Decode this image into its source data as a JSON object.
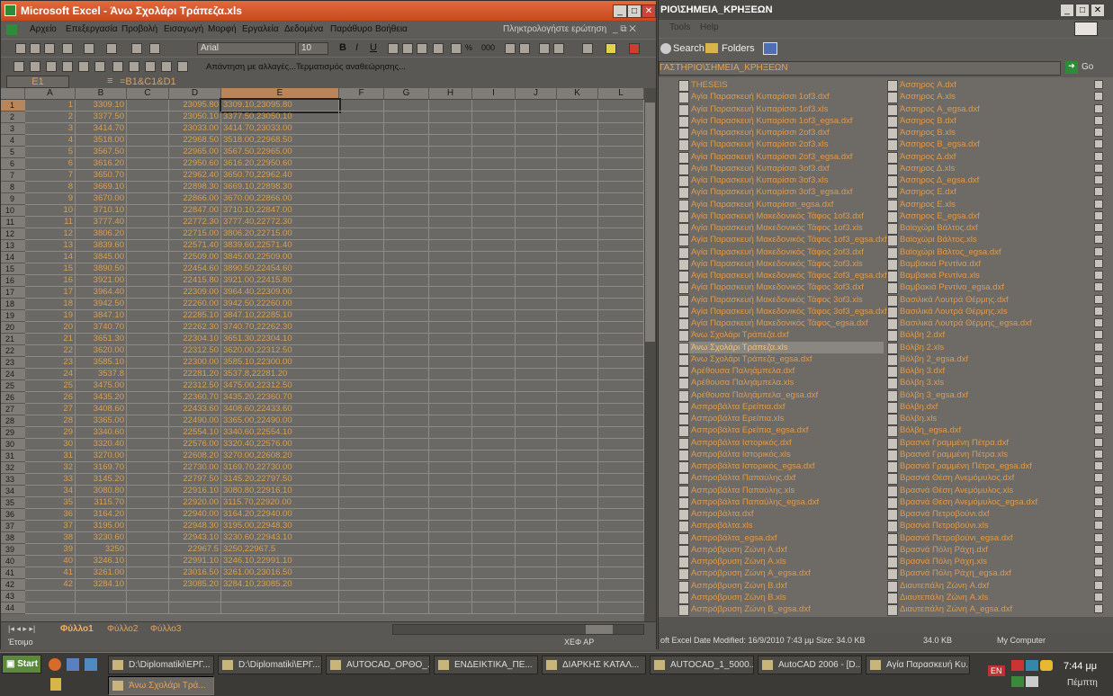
{
  "excel": {
    "title": "Microsoft Excel - Άνω Σχολάρι Τράπεζα.xls",
    "help_placeholder": "Πληκτρολογήστε ερώτηση",
    "menu": [
      "Αρχείο",
      "Επεξεργασία",
      "Προβολή",
      "Εισαγωγή",
      "Μορφή",
      "Εργαλεία",
      "Δεδομένα",
      "Παράθυρο",
      "Βοήθεια"
    ],
    "font_name": "Arial",
    "font_size": "10",
    "review_text": "Απάντηση με αλλαγές...",
    "end_review_text": "Τερματισμός αναθεώρησης...",
    "name_box": "E1",
    "formula": "=B1&C1&D1",
    "columns": [
      "A",
      "B",
      "C",
      "D",
      "E",
      "F",
      "G",
      "H",
      "I",
      "J",
      "K",
      "L"
    ],
    "rows": [
      [
        "1",
        "3309.10",
        "",
        "23095.80",
        "3309.10,23095.80"
      ],
      [
        "2",
        "3377.50",
        "",
        "23050.10",
        "3377.50,23050.10"
      ],
      [
        "3",
        "3414.70",
        "",
        "23033.00",
        "3414.70,23033.00"
      ],
      [
        "4",
        "3518.00",
        "",
        "22968.50",
        "3518.00,22968.50"
      ],
      [
        "5",
        "3567.50",
        "",
        "22965.00",
        "3567.50,22965.00"
      ],
      [
        "6",
        "3616.20",
        "",
        "22950.60",
        "3616.20,22950.60"
      ],
      [
        "7",
        "3650.70",
        "",
        "22962.40",
        "3650.70,22962.40"
      ],
      [
        "8",
        "3669.10",
        "",
        "22898.30",
        "3669.10,22898.30"
      ],
      [
        "9",
        "3670.00",
        "",
        "22866.00",
        "3670.00,22866.00"
      ],
      [
        "10",
        "3710.10",
        "",
        "22847.00",
        "3710.10,22847.00"
      ],
      [
        "11",
        "3777.40",
        "",
        "22772.30",
        "3777.40,22772.30"
      ],
      [
        "12",
        "3806.20",
        "",
        "22715.00",
        "3806.20,22715.00"
      ],
      [
        "13",
        "3839.60",
        "",
        "22571.40",
        "3839.60,22571.40"
      ],
      [
        "14",
        "3845.00",
        "",
        "22509.00",
        "3845.00,22509.00"
      ],
      [
        "15",
        "3890.50",
        "",
        "22454.60",
        "3890.50,22454.60"
      ],
      [
        "16",
        "3921.00",
        "",
        "22415.80",
        "3921.00,22415.80"
      ],
      [
        "17",
        "3964.40",
        "",
        "22309.00",
        "3964.40,22309.00"
      ],
      [
        "18",
        "3942.50",
        "",
        "22260.00",
        "3942.50,22260.00"
      ],
      [
        "19",
        "3847.10",
        "",
        "22285.10",
        "3847.10,22285.10"
      ],
      [
        "20",
        "3740.70",
        "",
        "22262.30",
        "3740.70,22262.30"
      ],
      [
        "21",
        "3651.30",
        "",
        "22304.10",
        "3651.30,22304.10"
      ],
      [
        "22",
        "3620.00",
        "",
        "22312.50",
        "3620.00,22312.50"
      ],
      [
        "23",
        "3585.10",
        "",
        "22300.00",
        "3585.10,22300.00"
      ],
      [
        "24",
        "3537.8",
        "",
        "22281.20",
        "3537.8,22281.20"
      ],
      [
        "25",
        "3475.00",
        "",
        "22312.50",
        "3475.00,22312.50"
      ],
      [
        "26",
        "3435.20",
        "",
        "22360.70",
        "3435.20,22360.70"
      ],
      [
        "27",
        "3408.60",
        "",
        "22433.60",
        "3408.60,22433.60"
      ],
      [
        "28",
        "3365.00",
        "",
        "22490.00",
        "3365.00,22490.00"
      ],
      [
        "29",
        "3340.60",
        "",
        "22554.10",
        "3340.60,22554.10"
      ],
      [
        "30",
        "3320.40",
        "",
        "22576.00",
        "3320.40,22576.00"
      ],
      [
        "31",
        "3270.00",
        "",
        "22608.20",
        "3270.00,22608.20"
      ],
      [
        "32",
        "3169.70",
        "",
        "22730.00",
        "3169.70,22730.00"
      ],
      [
        "33",
        "3145.20",
        "",
        "22797.50",
        "3145.20,22797.50"
      ],
      [
        "34",
        "3080.80",
        "",
        "22916.10",
        "3080.80,22916.10"
      ],
      [
        "35",
        "3115.70",
        "",
        "22920.00",
        "3115.70,22920.00"
      ],
      [
        "36",
        "3164.20",
        "",
        "22940.00",
        "3164.20,22940.00"
      ],
      [
        "37",
        "3195.00",
        "",
        "22948.30",
        "3195.00,22948.30"
      ],
      [
        "38",
        "3230.60",
        "",
        "22943.10",
        "3230.60,22943.10"
      ],
      [
        "39",
        "3250",
        "",
        "22967.5",
        "3250,22967.5"
      ],
      [
        "40",
        "3246.10",
        "",
        "22991.10",
        "3246.10,22991.10"
      ],
      [
        "41",
        "3261.00",
        "",
        "23016.50",
        "3261.00,23016.50"
      ],
      [
        "42",
        "3284.10",
        "",
        "23085.20",
        "3284.10,23085.20"
      ]
    ],
    "sheets": [
      "Φύλλο1",
      "Φύλλο2",
      "Φύλλο3"
    ],
    "status_left": "Έτοιμο",
    "status_right": "ΧΕΦ ΑΡ"
  },
  "explorer": {
    "title": "PIO\\ΣΗΜΕΙΑ_ΚΡΗΞΕΩΝ",
    "menu": [
      "Tools",
      "Help"
    ],
    "search": "Search",
    "folders": "Folders",
    "address": "ΓΑΣΤΗΡΙΟ\\ΣΗΜΕΙΑ_ΚΡΗΞΕΩΝ",
    "go": "Go",
    "col1": [
      "THESEIS",
      "Αγία Παρασκευή Κυπαρίσσι 1of3.dxf",
      "Αγία Παρασκευή Κυπαρίσσι 1of3.xls",
      "Αγία Παρασκευή Κυπαρίσσι 1of3_egsa.dxf",
      "Αγία Παρασκευή Κυπαρίσσι 2of3.dxf",
      "Αγία Παρασκευή Κυπαρίσσι 2of3.xls",
      "Αγία Παρασκευή Κυπαρίσσι 2of3_egsa.dxf",
      "Αγία Παρασκευή Κυπαρίσσι 3of3.dxf",
      "Αγία Παρασκευή Κυπαρίσσι 3of3.xls",
      "Αγία Παρασκευή Κυπαρίσσι 3of3_egsa.dxf",
      "Αγία Παρασκευή Κυπαρίσσι_egsa.dxf",
      "Αγία Παρασκευή Μακεδονικός Τάφος 1of3.dxf",
      "Αγία Παρασκευή Μακεδονικός Τάφος 1of3.xls",
      "Αγία Παρασκευή Μακεδονικός Τάφος 1of3_egsa.dxf",
      "Αγία Παρασκευή Μακεδονικός Τάφος 2of3.dxf",
      "Αγία Παρασκευή Μακεδονικός Τάφος 2of3.xls",
      "Αγία Παρασκευή Μακεδονικός Τάφος 2of3_egsa.dxf",
      "Αγία Παρασκευή Μακεδονικός Τάφος 3of3.dxf",
      "Αγία Παρασκευή Μακεδονικός Τάφος 3of3.xls",
      "Αγία Παρασκευή Μακεδονικός Τάφος 3of3_egsa.dxf",
      "Αγία Παρασκευή Μακεδονικός Τάφος_egsa.dxf",
      "Άνω Σχολάρι Τράπεζα.dxf",
      "Άνω Σχολάρι Τράπεζα.xls",
      "Άνω Σχολάρι Τράπεζα_egsa.dxf",
      "Αρέθουσα Παληάμπελα.dxf",
      "Αρέθουσα Παληάμπελα.xls",
      "Αρέθουσα Παληάμπελα_egsa.dxf",
      "Ασπροβάλτα Ερείπια.dxf",
      "Ασπροβάλτα Ερείπια.xls",
      "Ασπροβάλτα Ερείπια_egsa.dxf",
      "Ασπροβάλτα Ιστορικός.dxf",
      "Ασπροβάλτα Ιστορικός.xls",
      "Ασπροβάλτα Ιστορικός_egsa.dxf",
      "Ασπροβάλτα Παπαύλης.dxf",
      "Ασπροβάλτα Παπαύλης.xls",
      "Ασπροβάλτα Παπαύλης_egsa.dxf",
      "Ασπροβάλτα.dxf",
      "Ασπροβάλτα.xls",
      "Ασπροβάλτα_egsa.dxf",
      "Ασπρόβρυση Ζώνη A.dxf",
      "Ασπρόβρυση Ζώνη A.xls",
      "Ασπρόβρυση Ζώνη A_egsa.dxf",
      "Ασπρόβρυση Ζώνη B.dxf",
      "Ασπρόβρυση Ζώνη B.xls",
      "Ασπρόβρυση Ζώνη B_egsa.dxf"
    ],
    "col2": [
      "Άσσηρος A.dxf",
      "Άσσηρος A.xls",
      "Άσσηρος A_egsa.dxf",
      "Άσσηρος B.dxf",
      "Άσσηρος B.xls",
      "Άσσηρος B_egsa.dxf",
      "Άσσηρος Δ.dxf",
      "Άσσηρος Δ.xls",
      "Άσσηρος Δ_egsa.dxf",
      "Άσσηρος E.dxf",
      "Άσσηρος E.xls",
      "Άσσηρος E_egsa.dxf",
      "Βαϊοχώρι Βάλτος.dxf",
      "Βαϊοχώρι Βάλτος.xls",
      "Βαϊοχώρι Βάλτος_egsa.dxf",
      "Βαμβακιά Ρεντίνα.dxf",
      "Βαμβακιά Ρεντίνα.xls",
      "Βαμβακιά Ρεντίνα_egsa.dxf",
      "Βασιλικά Λουτρά Θέρμης.dxf",
      "Βασιλικά Λουτρά Θέρμης.xls",
      "Βασιλικά Λουτρά Θέρμης_egsa.dxf",
      "Βόλβη 2.dxf",
      "Βόλβη 2.xls",
      "Βόλβη 2_egsa.dxf",
      "Βόλβη 3.dxf",
      "Βόλβη 3.xls",
      "Βόλβη 3_egsa.dxf",
      "Βόλβη.dxf",
      "Βόλβη.xls",
      "Βόλβη_egsa.dxf",
      "Βρασνά Γραμμένη Πέτρα.dxf",
      "Βρασνά Γραμμένη Πέτρα.xls",
      "Βρασνά Γραμμένη Πέτρα_egsa.dxf",
      "Βρασνά Θέση Ανεμόμυλος.dxf",
      "Βρασνά Θέση Ανεμόμυλος.xls",
      "Βρασνά Θέση Ανεμόμυλος_egsa.dxf",
      "Βρασνά Πετροβούνι.dxf",
      "Βρασνά Πετροβούνι.xls",
      "Βρασνά Πετροβούνι_egsa.dxf",
      "Βρασνά Πόλη Ράχη.dxf",
      "Βρασνά Πόλη Ράχη.xls",
      "Βρασνά Πόλη Ράχη_egsa.dxf",
      "Διαυτεπάλη Ζώνη A.dxf",
      "Διαυτεπάλη Ζώνη A.xls",
      "Διαυτεπάλη Ζώνη A_egsa.dxf"
    ],
    "status": "oft Excel Date Modified: 16/9/2010 7:43 μμ Size: 34.0 KB",
    "size": "34.0 KB",
    "location": "My Computer"
  },
  "taskbar": {
    "start": "Start",
    "tasks": [
      "D:\\Diplomatiki\\ΕΡΓ...",
      "D:\\Diplomatiki\\ΕΡΓ...",
      "AUTOCAD_ΟΡΘΟ_...",
      "ΕΝΔΕΙΚΤΙΚΑ_ΠΕ...",
      "ΔΙΑΡΚΗΣ ΚΑΤΑΛ...",
      "AUTOCAD_1_5000...",
      "AutoCAD 2006 - [D...",
      "Αγία Παρασκευή Κυ..."
    ],
    "task_row2": "Άνω Σχολάρι Τρά...",
    "lang": "EN",
    "time": "7:44 μμ",
    "day": "Πέμπτη"
  }
}
